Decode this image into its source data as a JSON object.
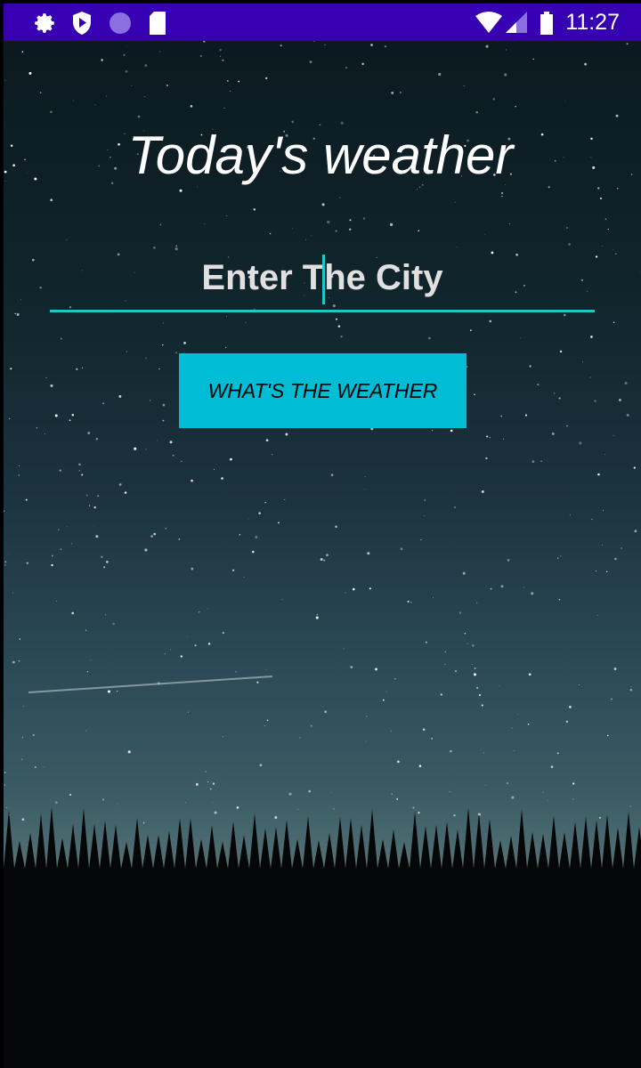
{
  "status_bar": {
    "time": "11:27",
    "icons": [
      "settings-icon",
      "play-protect-icon",
      "sync-icon",
      "sd-card-icon",
      "wifi-icon",
      "signal-icon",
      "battery-icon"
    ],
    "color": "#3700b3"
  },
  "main": {
    "title": "Today's weather",
    "city_input": {
      "value": "Enter The City"
    },
    "button_label": "WHAT'S THE WEATHER",
    "accent": "#00bcd4"
  }
}
